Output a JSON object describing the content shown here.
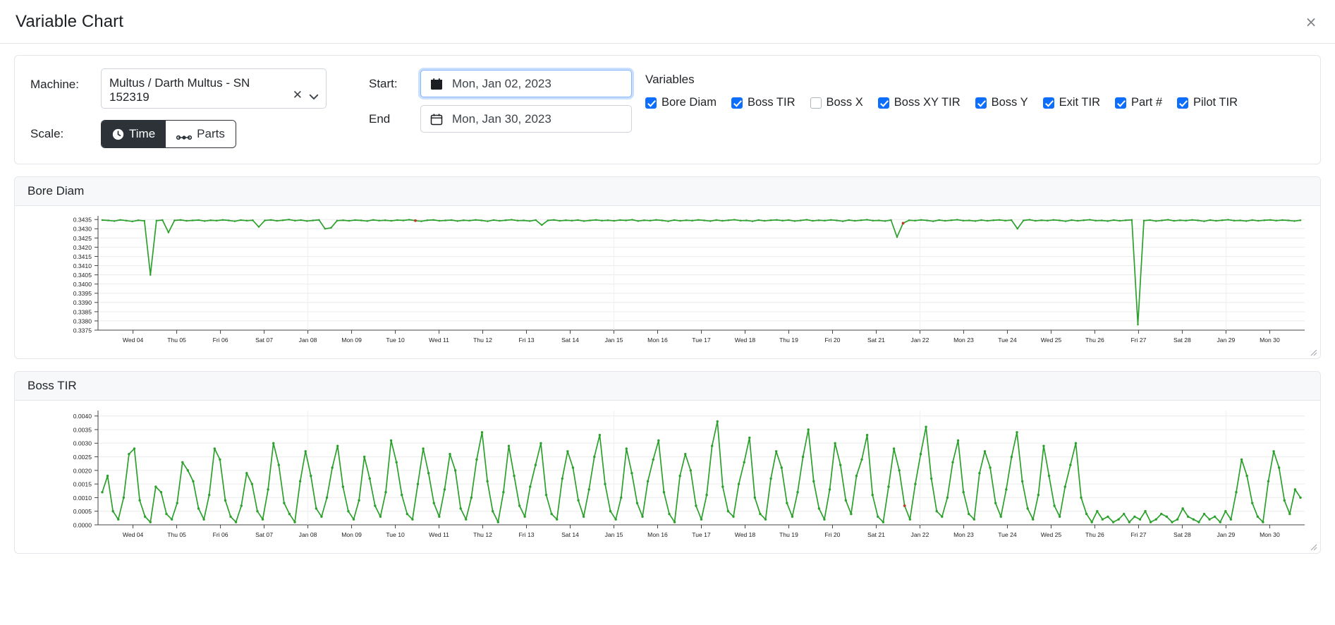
{
  "window": {
    "title": "Variable Chart",
    "close_label": "×"
  },
  "controls": {
    "machine_label": "Machine:",
    "machine_value": "Multus / Darth Multus - SN 152319",
    "machine_clear_icon": "clear-icon",
    "machine_caret_icon": "chevron-down-icon",
    "scale_label": "Scale:",
    "scale_options": [
      {
        "label": "Time",
        "icon": "clock-icon",
        "active": true
      },
      {
        "label": "Parts",
        "icon": "parts-icon",
        "active": false
      }
    ],
    "start_label": "Start:",
    "start_value": "Mon, Jan 02, 2023",
    "start_focused": true,
    "end_label": "End",
    "end_value": "Mon, Jan 30, 2023",
    "end_focused": false,
    "calendar_icon": "calendar-icon"
  },
  "variables": {
    "title": "Variables",
    "items": [
      {
        "label": "Bore Diam",
        "checked": true
      },
      {
        "label": "Boss TIR",
        "checked": true
      },
      {
        "label": "Boss X",
        "checked": false
      },
      {
        "label": "Boss XY TIR",
        "checked": true
      },
      {
        "label": "Boss Y",
        "checked": true
      },
      {
        "label": "Exit TIR",
        "checked": true
      },
      {
        "label": "Part #",
        "checked": true
      },
      {
        "label": "Pilot TIR",
        "checked": true
      }
    ]
  },
  "colors": {
    "series_green": "#2ca02c",
    "marker_red": "#c0392b",
    "accent_blue": "#0d6efd",
    "toggle_dark": "#2c3238",
    "grid": "#ececec"
  },
  "chart_data": [
    {
      "type": "line",
      "title": "Bore Diam",
      "xlabel": "",
      "ylabel": "",
      "grid": true,
      "legend": "none",
      "ylim": [
        0.3375,
        0.3437
      ],
      "yticks": [
        0.3375,
        0.338,
        0.3385,
        0.339,
        0.3395,
        0.34,
        0.3405,
        0.341,
        0.3415,
        0.342,
        0.3425,
        0.343,
        0.3435
      ],
      "ytick_labels": [
        "0.3375",
        "0.3380",
        "0.3385",
        "0.3390",
        "0.3395",
        "0.3400",
        "0.3405",
        "0.3410",
        "0.3415",
        "0.3420",
        "0.3425",
        "0.3430",
        "0.3435"
      ],
      "xtick_labels": [
        "Wed 04",
        "Thu 05",
        "Fri 06",
        "Sat 07",
        "Jan 08",
        "Mon 09",
        "Tue 10",
        "Wed 11",
        "Thu 12",
        "Fri 13",
        "Sat 14",
        "Jan 15",
        "Mon 16",
        "Tue 17",
        "Wed 18",
        "Thu 19",
        "Fri 20",
        "Sat 21",
        "Jan 22",
        "Mon 23",
        "Tue 24",
        "Wed 25",
        "Thu 26",
        "Fri 27",
        "Sat 28",
        "Jan 29",
        "Mon 30"
      ],
      "series": [
        {
          "name": "Bore Diam",
          "color": "#2ca02c",
          "baseline": 0.34345,
          "noise": 0.00012,
          "values": [
            0.34347,
            0.34345,
            0.34342,
            0.34348,
            0.34344,
            0.3434,
            0.34346,
            0.34343,
            0.3405,
            0.34344,
            0.34347,
            0.3428,
            0.34345,
            0.34348,
            0.34343,
            0.34345,
            0.34347,
            0.34342,
            0.34346,
            0.34344,
            0.34348,
            0.34345,
            0.34341,
            0.34347,
            0.34344,
            0.34346,
            0.3431,
            0.34345,
            0.34348,
            0.34343,
            0.34346,
            0.3435,
            0.34344,
            0.34347,
            0.34342,
            0.34345,
            0.34348,
            0.343,
            0.34305,
            0.34344,
            0.34346,
            0.34343,
            0.34347,
            0.34345,
            0.34342,
            0.34348,
            0.34344,
            0.34346,
            0.34343,
            0.34347,
            0.34345,
            0.34349,
            0.34344,
            0.34341,
            0.34346,
            0.34348,
            0.34343,
            0.34345,
            0.34347,
            0.34342,
            0.34346,
            0.34344,
            0.34348,
            0.34345,
            0.34341,
            0.34347,
            0.34343,
            0.34346,
            0.34349,
            0.34344,
            0.34345,
            0.34342,
            0.34347,
            0.3432,
            0.34345,
            0.34348,
            0.34343,
            0.34346,
            0.34344,
            0.34347,
            0.34342,
            0.34345,
            0.34348,
            0.34344,
            0.34346,
            0.34343,
            0.34347,
            0.34345,
            0.34349,
            0.34342,
            0.34346,
            0.34344,
            0.34348,
            0.34345,
            0.34341,
            0.34347,
            0.34343,
            0.34346,
            0.34344,
            0.34348,
            0.34345,
            0.34342,
            0.34347,
            0.34343,
            0.34346,
            0.34349,
            0.34344,
            0.34345,
            0.34341,
            0.34347,
            0.34343,
            0.34346,
            0.34348,
            0.34344,
            0.34347,
            0.34342,
            0.34345,
            0.34349,
            0.34343,
            0.34346,
            0.34344,
            0.34348,
            0.34345,
            0.34341,
            0.34347,
            0.34343,
            0.34346,
            0.34349,
            0.34344,
            0.34345,
            0.34342,
            0.34347,
            0.34255,
            0.3433,
            0.34346,
            0.34344,
            0.34348,
            0.34345,
            0.34341,
            0.34347,
            0.34343,
            0.34346,
            0.34349,
            0.34344,
            0.34345,
            0.34342,
            0.34347,
            0.34343,
            0.34346,
            0.34348,
            0.34344,
            0.34347,
            0.343,
            0.34345,
            0.34349,
            0.34343,
            0.34346,
            0.34344,
            0.34348,
            0.34345,
            0.34341,
            0.34347,
            0.34343,
            0.34346,
            0.34349,
            0.34344,
            0.34345,
            0.34342,
            0.34347,
            0.34343,
            0.34346,
            0.34348,
            0.3378,
            0.34344,
            0.34347,
            0.34342,
            0.34345,
            0.34349,
            0.34343,
            0.34346,
            0.34344,
            0.34348,
            0.34345,
            0.34341,
            0.34347,
            0.34343,
            0.34346,
            0.34349,
            0.34344,
            0.34345,
            0.34342,
            0.34347,
            0.34343,
            0.34346,
            0.34348,
            0.34344,
            0.34347,
            0.34345,
            0.34342,
            0.34346
          ]
        }
      ]
    },
    {
      "type": "line",
      "title": "Boss TIR",
      "xlabel": "",
      "ylabel": "",
      "grid": true,
      "legend": "none",
      "ylim": [
        0.0,
        0.0042
      ],
      "yticks": [
        0.0,
        0.0005,
        0.001,
        0.0015,
        0.002,
        0.0025,
        0.003,
        0.0035,
        0.004
      ],
      "ytick_labels": [
        "0.0000",
        "0.0005",
        "0.0010",
        "0.0015",
        "0.0020",
        "0.0025",
        "0.0030",
        "0.0035",
        "0.0040"
      ],
      "xtick_labels": [
        "Wed 04",
        "Thu 05",
        "Fri 06",
        "Sat 07",
        "Jan 08",
        "Mon 09",
        "Tue 10",
        "Wed 11",
        "Thu 12",
        "Fri 13",
        "Sat 14",
        "Jan 15",
        "Mon 16",
        "Tue 17",
        "Wed 18",
        "Thu 19",
        "Fri 20",
        "Sat 21",
        "Jan 22",
        "Mon 23",
        "Tue 24",
        "Wed 25",
        "Thu 26",
        "Fri 27",
        "Sat 28",
        "Jan 29",
        "Mon 30"
      ],
      "series": [
        {
          "name": "Boss TIR",
          "color": "#2ca02c",
          "values": [
            0.0012,
            0.0018,
            0.0005,
            0.0002,
            0.001,
            0.0026,
            0.0028,
            0.0009,
            0.0003,
            0.0001,
            0.0014,
            0.0012,
            0.0004,
            0.0002,
            0.0008,
            0.0023,
            0.002,
            0.0016,
            0.0006,
            0.0002,
            0.0011,
            0.0028,
            0.0024,
            0.0009,
            0.0003,
            0.0001,
            0.0007,
            0.0019,
            0.0015,
            0.0005,
            0.0002,
            0.0013,
            0.003,
            0.0022,
            0.0008,
            0.0004,
            0.0001,
            0.0016,
            0.0027,
            0.0018,
            0.0006,
            0.0003,
            0.001,
            0.0021,
            0.0029,
            0.0014,
            0.0005,
            0.0002,
            0.0009,
            0.0025,
            0.0017,
            0.0007,
            0.0003,
            0.0012,
            0.0031,
            0.0023,
            0.0011,
            0.0004,
            0.0002,
            0.0015,
            0.0028,
            0.0019,
            0.0008,
            0.0003,
            0.0013,
            0.0026,
            0.002,
            0.0006,
            0.0002,
            0.001,
            0.0024,
            0.0034,
            0.0016,
            0.0005,
            0.0001,
            0.0012,
            0.0029,
            0.0018,
            0.0007,
            0.0003,
            0.0014,
            0.0022,
            0.003,
            0.0011,
            0.0004,
            0.0002,
            0.0017,
            0.0027,
            0.0021,
            0.0009,
            0.0003,
            0.0013,
            0.0025,
            0.0033,
            0.0015,
            0.0005,
            0.0002,
            0.001,
            0.0028,
            0.0019,
            0.0008,
            0.0003,
            0.0016,
            0.0024,
            0.0031,
            0.0012,
            0.0004,
            0.0001,
            0.0018,
            0.0026,
            0.002,
            0.0007,
            0.0002,
            0.0011,
            0.0029,
            0.0038,
            0.0014,
            0.0005,
            0.0003,
            0.0015,
            0.0023,
            0.0032,
            0.001,
            0.0004,
            0.0002,
            0.0017,
            0.0027,
            0.0021,
            0.0008,
            0.0003,
            0.0012,
            0.0025,
            0.0035,
            0.0016,
            0.0006,
            0.0002,
            0.0013,
            0.003,
            0.0022,
            0.0009,
            0.0004,
            0.0018,
            0.0024,
            0.0033,
            0.0011,
            0.0003,
            0.0001,
            0.0014,
            0.0028,
            0.002,
            0.0007,
            0.0002,
            0.0015,
            0.0026,
            0.0036,
            0.0017,
            0.0005,
            0.0003,
            0.001,
            0.0023,
            0.0031,
            0.0012,
            0.0004,
            0.0002,
            0.0019,
            0.0027,
            0.0021,
            0.0008,
            0.0003,
            0.0013,
            0.0025,
            0.0034,
            0.0016,
            0.0006,
            0.0002,
            0.0011,
            0.0029,
            0.0018,
            0.0007,
            0.0003,
            0.0014,
            0.0022,
            0.003,
            0.001,
            0.0004,
            0.0001,
            0.0005,
            0.0002,
            0.0003,
            0.0001,
            0.0002,
            0.0004,
            0.0001,
            0.0003,
            0.0002,
            0.0005,
            0.0001,
            0.0002,
            0.0004,
            0.0003,
            0.0001,
            0.0002,
            0.0006,
            0.0003,
            0.0002,
            0.0001,
            0.0004,
            0.0002,
            0.0003,
            0.0001,
            0.0005,
            0.0002,
            0.0012,
            0.0024,
            0.0018,
            0.0008,
            0.0003,
            0.0001,
            0.0016,
            0.0027,
            0.0021,
            0.0009,
            0.0004,
            0.0013,
            0.001
          ]
        }
      ]
    }
  ]
}
